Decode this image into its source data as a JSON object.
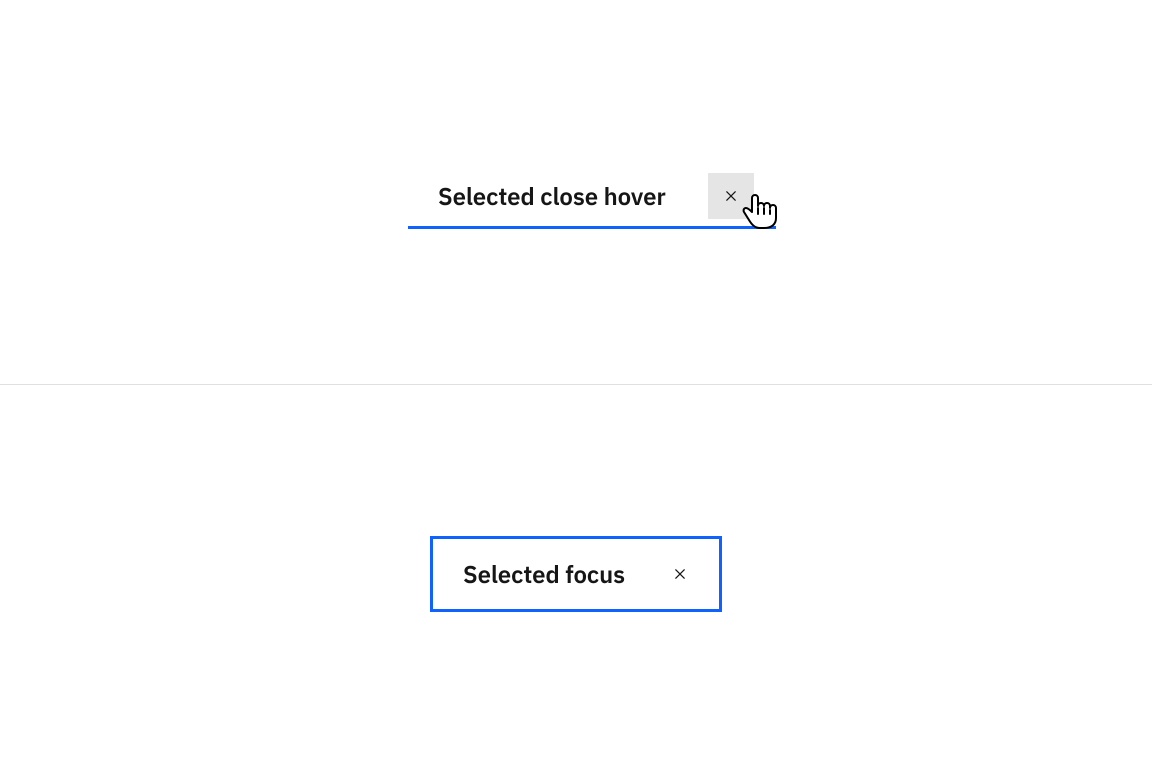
{
  "colors": {
    "focus": "#0f62fe",
    "hoverBg": "#e5e5e5",
    "text": "#161616"
  },
  "tabs": {
    "hover": {
      "label": "Selected close hover"
    },
    "focus": {
      "label": "Selected focus"
    }
  }
}
